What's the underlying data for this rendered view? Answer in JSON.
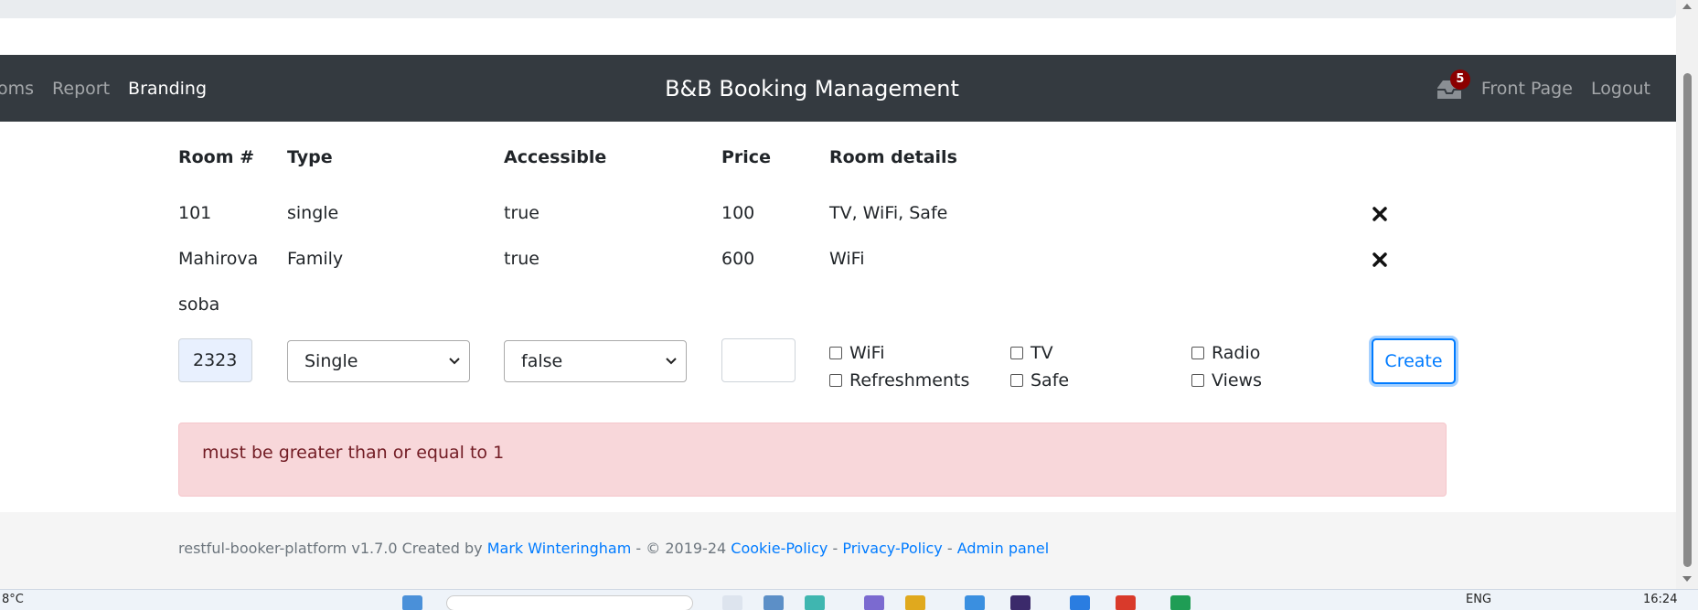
{
  "nav": {
    "links": [
      "oms",
      "Report",
      "Branding"
    ],
    "title": "B&B Booking Management",
    "notification_count": "5",
    "front_page": "Front Page",
    "logout": "Logout"
  },
  "table": {
    "headers": [
      "Room #",
      "Type",
      "Accessible",
      "Price",
      "Room details"
    ],
    "rows": [
      {
        "room": "101",
        "type": "single",
        "accessible": "true",
        "price": "100",
        "details": "TV, WiFi, Safe"
      },
      {
        "room": "Mahirova",
        "room_line2": "soba",
        "type": "Family",
        "accessible": "true",
        "price": "600",
        "details": "WiFi"
      }
    ]
  },
  "form": {
    "room_value": "2323",
    "type_value": "Single",
    "accessible_value": "false",
    "price_value": "",
    "checkboxes": [
      "WiFi",
      "TV",
      "Radio",
      "Refreshments",
      "Safe",
      "Views"
    ],
    "create_label": "Create"
  },
  "alert": {
    "message": "must be greater than or equal to 1"
  },
  "footer": {
    "prefix": "restful-booker-platform v1.7.0 Created by ",
    "author": "Mark Winteringham",
    "copyright": " - © 2019-24 ",
    "cookie": "Cookie-Policy",
    "sep": " - ",
    "privacy": "Privacy-Policy",
    "admin": "Admin panel"
  },
  "taskbar": {
    "temp": "8°C",
    "lang": "ENG",
    "time": "16:24"
  },
  "colors": {
    "navbar": "#343a40",
    "alert_bg": "#f8d7da",
    "link": "#007bff"
  }
}
